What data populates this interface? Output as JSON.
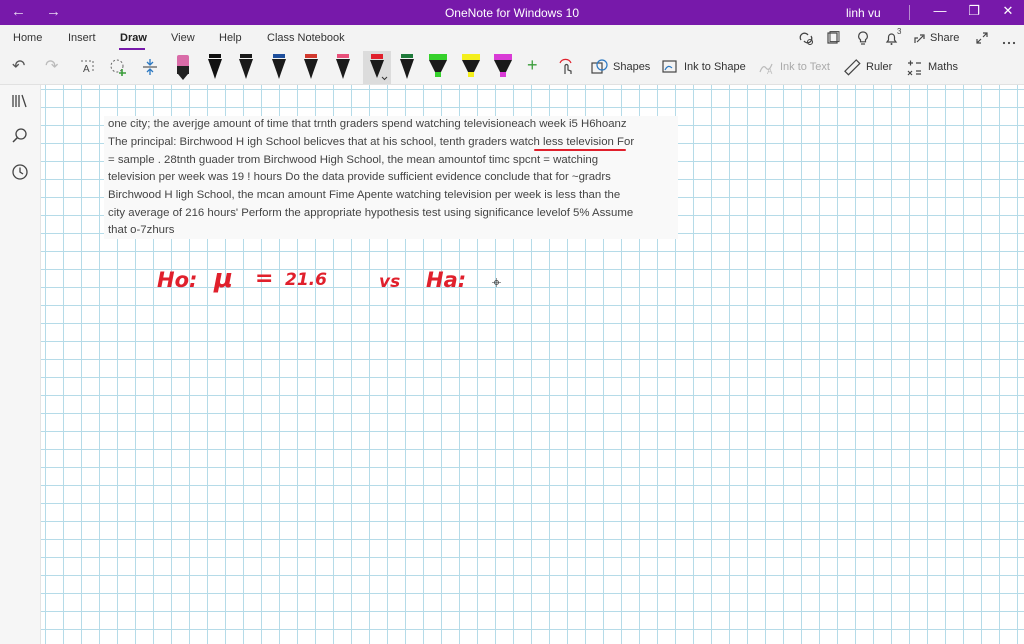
{
  "window": {
    "title": "OneNote for Windows 10",
    "user": "linh vu",
    "back_glyph": "←",
    "forward_glyph": "→",
    "minimize_glyph": "—",
    "restore_glyph": "❐",
    "close_glyph": "✕"
  },
  "ribbon": {
    "tabs": [
      "Home",
      "Insert",
      "Draw",
      "View",
      "Help",
      "Class Notebook"
    ],
    "active_tab": "Draw",
    "share_label": "Share",
    "notification_count": "3",
    "tools": {
      "undo_glyph": "↶",
      "redo_glyph": "↷",
      "shapes_label": "Shapes",
      "ink_to_shape_label": "Ink to Shape",
      "ink_to_text_label": "Ink to Text",
      "ruler_label": "Ruler",
      "maths_label": "Maths",
      "plus_glyph": "+"
    },
    "pens": [
      {
        "color": "#d96ca8",
        "type": "marker"
      },
      {
        "color": "#111111",
        "type": "pen"
      },
      {
        "color": "#1a1a1a",
        "type": "pen"
      },
      {
        "color": "#1e4f9c",
        "type": "pen"
      },
      {
        "color": "#d23a2f",
        "type": "pen"
      },
      {
        "color": "#6b3fa0",
        "type": "pen"
      },
      {
        "color": "#e8507a",
        "type": "pen"
      },
      {
        "color": "#e0202c",
        "type": "pen",
        "selected": true
      },
      {
        "color": "#1f7a3a",
        "type": "pen"
      },
      {
        "color": "#35d12b",
        "type": "highlighter"
      },
      {
        "color": "#f4ef1d",
        "type": "highlighter"
      },
      {
        "color": "#d93bd6",
        "type": "highlighter"
      }
    ],
    "accent_color": "#7719aa"
  },
  "problem_text": [
    "one city; the averjge amount of time that trnth graders spend watching televisioneach week i5 H6hoanz",
    "The principal: Birchwood H igh School belicves that at his school, tenth graders watch less television For",
    "= sample . 28tnth guader trom Birchwood High School, the mean amountof timc spcnt = watching",
    "television per week was 19 ! hours Do the data provide sufficient evidence conclude that for ~gradrs",
    "Birchwood H ligh School, the mcan amount Fime Apente watching television per week is less than the",
    "city average of 216 hours' Perform the appropriate hypothesis test using significance levelof 5% Assume",
    "that o-7zhurs"
  ],
  "handwriting": {
    "h0": "Ho:",
    "mu": "μ",
    "equals": "=",
    "value": "21.6",
    "vs": "vs",
    "ha": "Ha:",
    "ink_color": "#e0202c"
  }
}
